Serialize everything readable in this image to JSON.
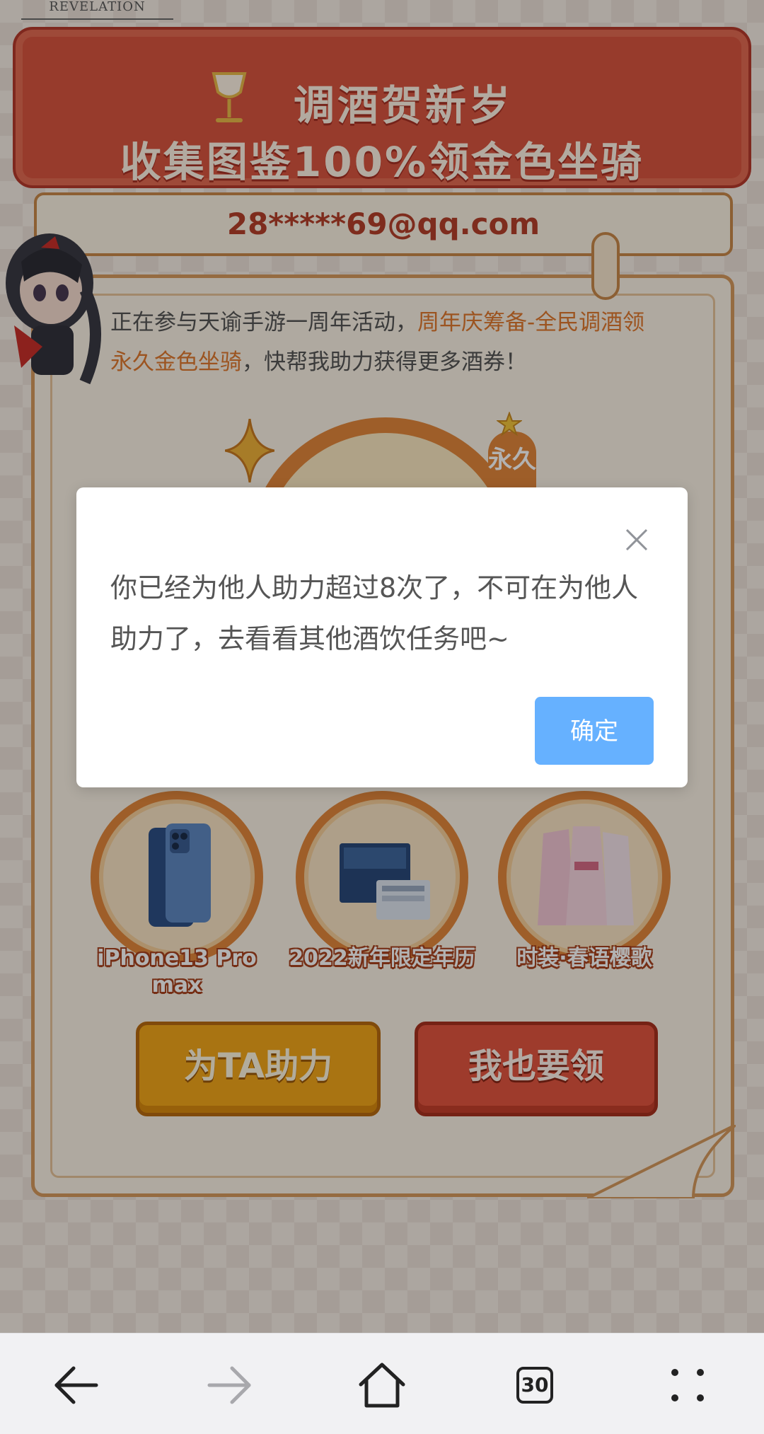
{
  "header": {
    "logo_text": "REVELATION"
  },
  "banner": {
    "line1": "调酒贺新岁",
    "line2": "收集图鉴100%领金色坐骑"
  },
  "account": {
    "email": "28*****69@qq.com"
  },
  "intro": {
    "part1": "正在参与天谕手游一周年活动，",
    "highlight1": "周年庆筹备-全民调酒领永久金色坐骑",
    "part2": "，快帮我助力获得更多酒券！"
  },
  "featured_prize": {
    "ribbon_text": "永久"
  },
  "prizes": [
    {
      "label": "iPhone13 Pro max",
      "icon": "phone-image"
    },
    {
      "label": "2022新年限定年历",
      "icon": "calendar-box-image"
    },
    {
      "label": "时装·春语樱歌",
      "icon": "costume-image"
    }
  ],
  "actions": {
    "help_label": "为TA助力",
    "claim_label": "我也要领"
  },
  "dialog": {
    "message": "你已经为他人助力超过8次了，不可在为他人助力了，去看看其他酒饮任务吧~",
    "confirm_label": "确定",
    "confirm_color": "#66b1ff"
  },
  "toolbar": {
    "tabs_count": "30",
    "icons": [
      "back-arrow-icon",
      "forward-arrow-icon",
      "home-icon",
      "tabs-icon",
      "menu-dots-icon"
    ]
  }
}
